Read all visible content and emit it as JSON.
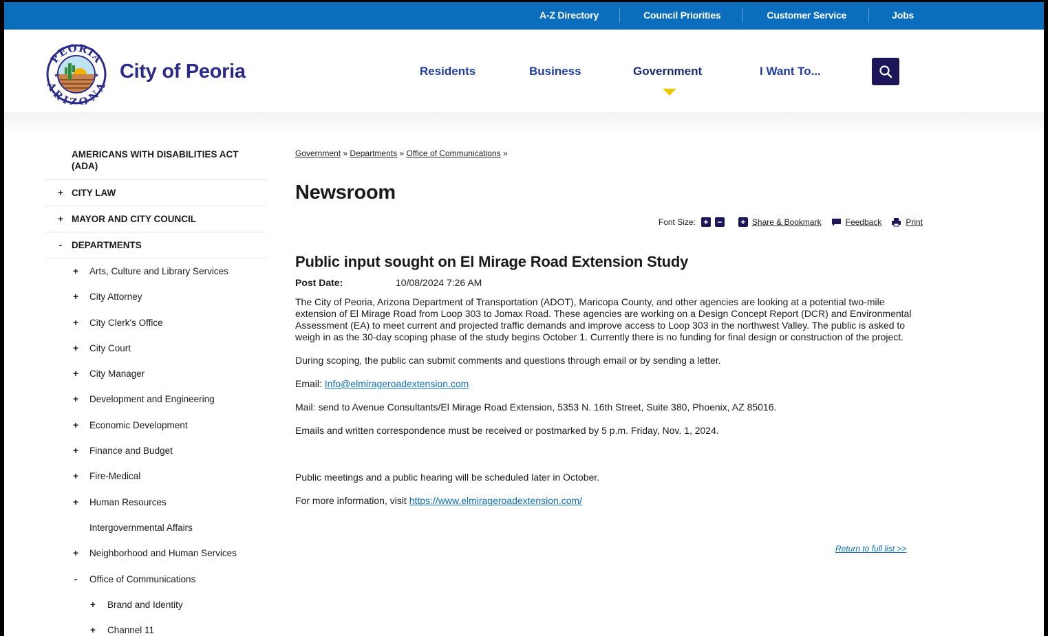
{
  "utility_nav": {
    "items": [
      "A-Z Directory",
      "Council Priorities",
      "Customer Service",
      "Jobs"
    ]
  },
  "header": {
    "site_name": "City of Peoria",
    "seal_text_top": "PEORIA",
    "seal_text_bottom": "ARIZONA",
    "nav": [
      "Residents",
      "Business",
      "Government",
      "I Want To..."
    ],
    "active_nav": "Government",
    "search_icon": "search-icon"
  },
  "sidebar": {
    "ada": "AMERICANS WITH DISABILITIES ACT (ADA)",
    "top_items": [
      {
        "mark": "+",
        "label": "CITY LAW"
      },
      {
        "mark": "+",
        "label": "MAYOR AND CITY COUNCIL"
      },
      {
        "mark": "-",
        "label": "DEPARTMENTS"
      }
    ],
    "departments": [
      {
        "mark": "+",
        "label": "Arts, Culture and Library Services"
      },
      {
        "mark": "+",
        "label": "City Attorney"
      },
      {
        "mark": "+",
        "label": "City Clerk's Office"
      },
      {
        "mark": "+",
        "label": "City Court"
      },
      {
        "mark": "+",
        "label": "City Manager"
      },
      {
        "mark": "+",
        "label": "Development and Engineering"
      },
      {
        "mark": "+",
        "label": "Economic Development"
      },
      {
        "mark": "+",
        "label": "Finance and Budget"
      },
      {
        "mark": "+",
        "label": "Fire-Medical"
      },
      {
        "mark": "+",
        "label": "Human Resources"
      },
      {
        "mark": "",
        "label": "Intergovernmental Affairs"
      },
      {
        "mark": "+",
        "label": "Neighborhood and Human Services"
      },
      {
        "mark": "-",
        "label": "Office of Communications"
      }
    ],
    "communications_children": [
      {
        "mark": "+",
        "label": "Brand and Identity"
      },
      {
        "mark": "+",
        "label": "Channel 11"
      }
    ]
  },
  "breadcrumb": {
    "items": [
      "Government",
      "Departments",
      "Office of Communications"
    ],
    "separator": "»"
  },
  "page_title": "Newsroom",
  "toolbar": {
    "font_size_label": "Font Size:",
    "share": "Share & Bookmark",
    "feedback": "Feedback",
    "print": "Print"
  },
  "article": {
    "title": "Public input sought on El Mirage Road Extension Study",
    "post_date_label": "Post Date:",
    "post_date": "10/08/2024 7:26 AM",
    "p1": "The City of Peoria, Arizona Department of Transportation (ADOT), Maricopa County, and other agencies are looking at a potential two-mile extension of El Mirage Road from Loop 303 to Jomax Road. These agencies are working on a Design Concept Report (DCR) and Environmental Assessment (EA) to meet current and projected traffic demands and improve access to Loop 303 in the northwest Valley. The public is asked to weigh in as the 30-day scoping phase of the study begins October 1. Currently there is no funding for final design or construction of the project.",
    "p2": "During scoping, the public can submit comments and questions through email or by sending a letter.",
    "email_label": "Email: ",
    "email": "Info@elmirageroadextension.com",
    "p4": "Mail: send to Avenue Consultants/El Mirage Road Extension, 5353 N. 16th Street, Suite 380, Phoenix, AZ 85016.",
    "p5": "Emails and written correspondence must be received or postmarked by 5 p.m. Friday, Nov. 1, 2024.",
    "p6": "Public meetings and a public hearing will be scheduled later in October.",
    "more_label": "For more information, visit ",
    "more_link": "https://www.elmirageroadextension.com/",
    "return": "Return to full list >>"
  },
  "colors": {
    "utility_bar": "#0a6ebd",
    "brand_navy": "#1c1659",
    "nav_blue": "#1f3c9e",
    "caret": "#f2c400",
    "link": "#0a6ebd"
  }
}
